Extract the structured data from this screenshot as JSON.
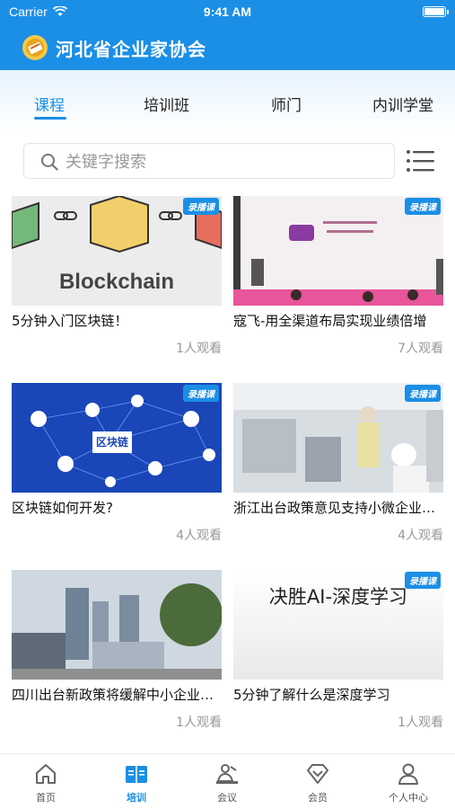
{
  "status_bar": {
    "carrier": "Carrier",
    "time": "9:41 AM"
  },
  "header": {
    "title": "河北省企业家协会"
  },
  "tabs": [
    {
      "label": "课程",
      "active": true
    },
    {
      "label": "培训班",
      "active": false
    },
    {
      "label": "师门",
      "active": false
    },
    {
      "label": "内训学堂",
      "active": false
    }
  ],
  "search": {
    "placeholder": "关键字搜索",
    "value": ""
  },
  "badge_label": "录播课",
  "courses": [
    {
      "title": "5分钟入门区块链！",
      "views": "1人观看",
      "thumb_text": "Blockchain",
      "badge": true
    },
    {
      "title": "寇飞-用全渠道布局实现业绩倍增",
      "views": "7人观看",
      "badge": true
    },
    {
      "title": "区块链如何开发?",
      "views": "4人观看",
      "thumb_text": "区块链",
      "badge": true
    },
    {
      "title": "浙江出台政策意见支持小微企业发展",
      "views": "4人观看",
      "badge": true
    },
    {
      "title": "四川出台新政策将缓解中小企业融资难",
      "views": "1人观看",
      "badge": false
    },
    {
      "title": "5分钟了解什么是深度学习",
      "views": "1人观看",
      "thumb_text": "决胜AI-深度学习",
      "badge": true
    }
  ],
  "bottom_nav": [
    {
      "label": "首页",
      "icon": "home-icon",
      "active": false
    },
    {
      "label": "培训",
      "icon": "book-icon",
      "active": true
    },
    {
      "label": "会议",
      "icon": "meeting-icon",
      "active": false
    },
    {
      "label": "会员",
      "icon": "diamond-icon",
      "active": false
    },
    {
      "label": "个人中心",
      "icon": "user-icon",
      "active": false
    }
  ],
  "colors": {
    "primary": "#1b8fe6",
    "muted_text": "#999999"
  }
}
